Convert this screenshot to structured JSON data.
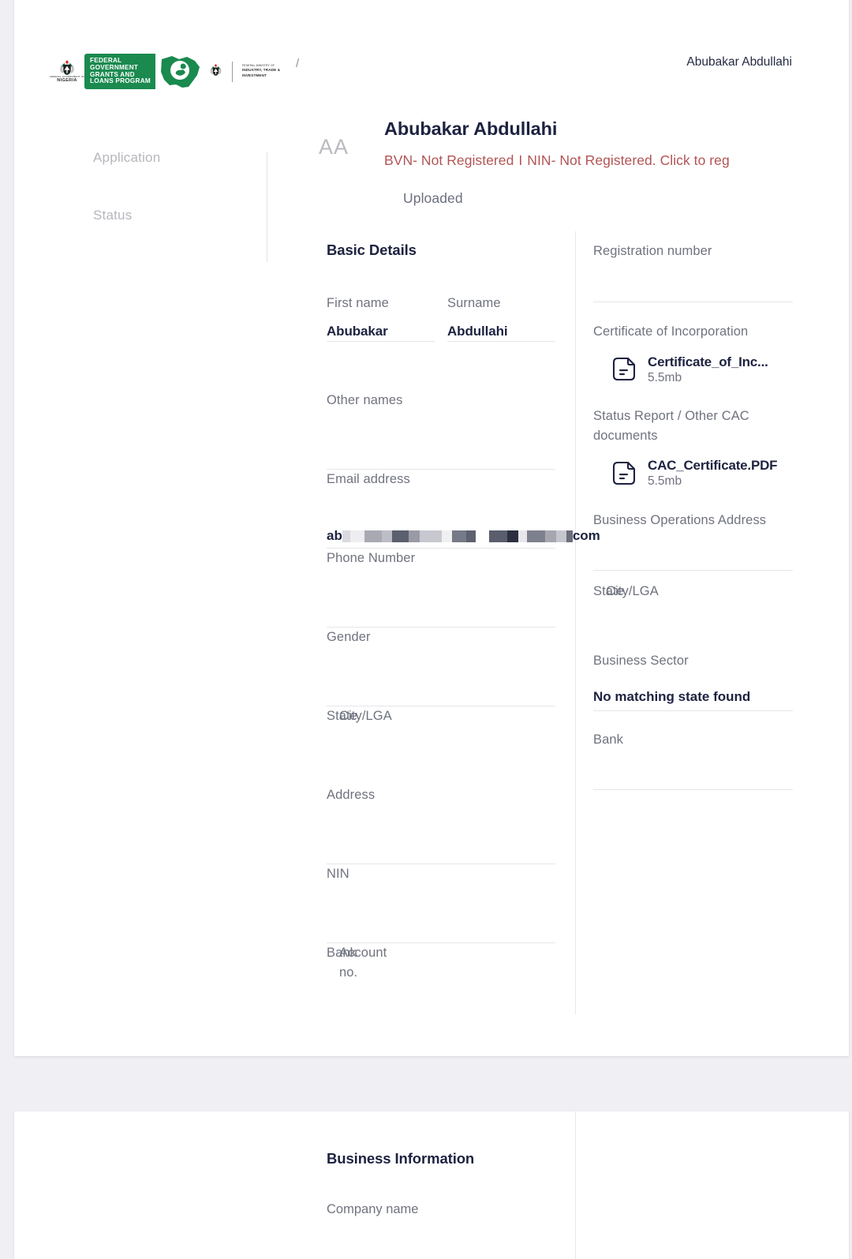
{
  "brand": {
    "coat_caption_small": "FEDERAL GOVERNMENT OF",
    "coat_caption_main": "NIGERIA",
    "program_line1": "FEDERAL",
    "program_line2": "GOVERNMENT",
    "program_line3": "GRANTS AND",
    "program_line4": "LOANS PROGRAM",
    "ministry_small": "FEDERAL MINISTRY OF",
    "ministry_line1": "INDUSTRY, TRADE &",
    "ministry_line2": "INVESTMENT",
    "green": "#1a8a4f"
  },
  "topbar": {
    "breadcrumb": "/",
    "user_name": "Abubakar Abdullahi"
  },
  "sidebar": {
    "items": [
      {
        "label": "Application"
      },
      {
        "label": "Status"
      }
    ]
  },
  "profile": {
    "avatar_initials": "AA",
    "name": "Abubakar Abdullahi",
    "bvn_status": "BVN- Not Registered",
    "separator": "I",
    "nin_status": "NIN- Not Registered. Click to reg",
    "alert_color": "#b35454",
    "uploaded_label": "Uploaded"
  },
  "basic_details": {
    "title": "Basic Details",
    "first_name": {
      "label": "First name",
      "value": "Abubakar"
    },
    "surname": {
      "label": "Surname",
      "value": "Abdullahi"
    },
    "other_names": {
      "label": "Other names",
      "value": ""
    },
    "email": {
      "label": "Email address",
      "prefix": "ab",
      "suffix": "com",
      "redacted": true
    },
    "phone": {
      "label": "Phone Number",
      "value": ""
    },
    "gender": {
      "label": "Gender",
      "value": ""
    },
    "state": {
      "label": "State",
      "value": ""
    },
    "city_lga": {
      "label": "City/LGA",
      "value": ""
    },
    "address": {
      "label": "Address",
      "value": ""
    },
    "nin": {
      "label": "NIN",
      "value": ""
    },
    "bank": {
      "label": "Bank",
      "value": ""
    },
    "account_no": {
      "label": "Account no.",
      "value": ""
    }
  },
  "documents": {
    "registration_number": {
      "label": "Registration number",
      "value": ""
    },
    "certificate_of_incorporation": {
      "label": "Certificate of Incorporation",
      "file_name": "Certificate_of_Inc...",
      "file_size": "5.5mb",
      "icon": "document-icon"
    },
    "status_report": {
      "label": "Status Report / Other CAC documents",
      "file_name": "CAC_Certificate.PDF",
      "file_size": "5.5mb",
      "icon": "document-icon"
    },
    "business_operations_address": {
      "label": "Business Operations Address",
      "value": ""
    },
    "biz_state": {
      "label": "State",
      "value": ""
    },
    "biz_city_lga": {
      "label": "City/LGA",
      "value": ""
    },
    "business_sector": {
      "label": "Business Sector",
      "value": "No matching state found"
    },
    "biz_bank": {
      "label": "Bank",
      "value": ""
    }
  },
  "business_information": {
    "title": "Business Information",
    "company_name": {
      "label": "Company name",
      "value": ""
    }
  }
}
